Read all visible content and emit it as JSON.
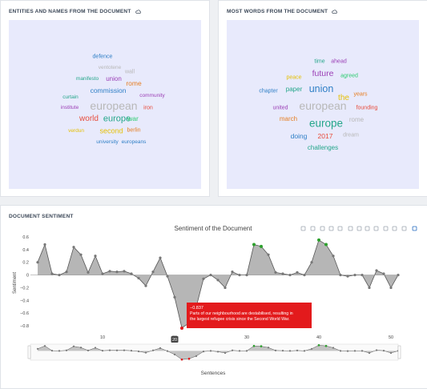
{
  "entities_card": {
    "title": "ENTITIES AND NAMES FROM THE DOCUMENT",
    "words": [
      {
        "text": "defence",
        "color": "#2f7fc6",
        "size": 7
      },
      {
        "text": "ventotene",
        "color": "#b8b8b8",
        "size": 6.5
      },
      {
        "text": "wall",
        "color": "#b8b8b8",
        "size": 7
      },
      {
        "text": "manifesto",
        "color": "#24a68a",
        "size": 6.5
      },
      {
        "text": "union",
        "color": "#9b3fb6",
        "size": 8
      },
      {
        "text": "rome",
        "color": "#e67e22",
        "size": 8.5
      },
      {
        "text": "commission",
        "color": "#2f7fc6",
        "size": 8.5
      },
      {
        "text": "curtain",
        "color": "#24a68a",
        "size": 6.5
      },
      {
        "text": "community",
        "color": "#9b3fb6",
        "size": 6.5
      },
      {
        "text": "institute",
        "color": "#9b3fb6",
        "size": 6.5
      },
      {
        "text": "european",
        "color": "#b8b8b8",
        "size": 14
      },
      {
        "text": "iron",
        "color": "#e74c3c",
        "size": 7
      },
      {
        "text": "world",
        "color": "#e74c3c",
        "size": 10
      },
      {
        "text": "europe",
        "color": "#24a68a",
        "size": 11
      },
      {
        "text": "war",
        "color": "#2ecc71",
        "size": 8.5
      },
      {
        "text": "verdun",
        "color": "#e5c007",
        "size": 6.5
      },
      {
        "text": "second",
        "color": "#e5c007",
        "size": 9
      },
      {
        "text": "berlin",
        "color": "#e67e22",
        "size": 7
      },
      {
        "text": "university",
        "color": "#2f7fc6",
        "size": 6.5
      },
      {
        "text": "europeans",
        "color": "#2f7fc6",
        "size": 6.5
      }
    ]
  },
  "words_card": {
    "title": "MOST WORDS FROM THE DOCUMENT",
    "words": [
      {
        "text": "time",
        "color": "#24a68a",
        "size": 7
      },
      {
        "text": "ahead",
        "color": "#9b3fb6",
        "size": 7
      },
      {
        "text": "future",
        "color": "#9b3fb6",
        "size": 10.5
      },
      {
        "text": "peace",
        "color": "#e5c007",
        "size": 7
      },
      {
        "text": "agreed",
        "color": "#2ecc71",
        "size": 7
      },
      {
        "text": "chapter",
        "color": "#2f7fc6",
        "size": 7
      },
      {
        "text": "paper",
        "color": "#24a68a",
        "size": 8
      },
      {
        "text": "union",
        "color": "#2f7fc6",
        "size": 12.5
      },
      {
        "text": "years",
        "color": "#e67e22",
        "size": 7
      },
      {
        "text": "the",
        "color": "#e5c007",
        "size": 10
      },
      {
        "text": "united",
        "color": "#9b3fb6",
        "size": 7
      },
      {
        "text": "european",
        "color": "#b8b8b8",
        "size": 14
      },
      {
        "text": "founding",
        "color": "#e74c3c",
        "size": 7
      },
      {
        "text": "march",
        "color": "#e67e22",
        "size": 8
      },
      {
        "text": "europe",
        "color": "#24a68a",
        "size": 13.5
      },
      {
        "text": "rome",
        "color": "#b8b8b8",
        "size": 8
      },
      {
        "text": "doing",
        "color": "#2f7fc6",
        "size": 8.5
      },
      {
        "text": "2017",
        "color": "#e74c3c",
        "size": 8.5
      },
      {
        "text": "dream",
        "color": "#b8b8b8",
        "size": 7
      },
      {
        "text": "challenges",
        "color": "#24a68a",
        "size": 8
      }
    ]
  },
  "sentiment_card": {
    "title": "DOCUMENT SENTIMENT",
    "toolbar_icons": [
      "camera-icon",
      "zoom-icon",
      "pan-icon",
      "box-select-icon",
      "lasso-icon",
      "zoom-in-icon",
      "zoom-out-icon",
      "autoscale-icon",
      "reset-axes-icon",
      "spike-lines-icon",
      "compare-hover-icon",
      "closest-hover-icon",
      "plotly-logo-icon"
    ]
  },
  "chart_data": {
    "type": "area",
    "title": "Sentiment of the Document",
    "xlabel": "Sentences",
    "ylabel": "Sentiment",
    "xlim": [
      0,
      51
    ],
    "ylim": [
      -0.9,
      0.65
    ],
    "x_ticks": [
      10,
      20,
      30,
      40,
      50
    ],
    "y_ticks": [
      0.6,
      0.4,
      0.2,
      0,
      -0.2,
      -0.4,
      -0.6,
      -0.8
    ],
    "y_tick_labels": [
      "0.6",
      "0.4",
      "0.2",
      "0",
      "−0.2",
      "−0.4",
      "−0.6",
      "−0.8"
    ],
    "grid": false,
    "fill_color": "#9e9e9e",
    "line_color": "#555555",
    "x": [
      1,
      2,
      3,
      4,
      5,
      6,
      7,
      8,
      9,
      10,
      11,
      12,
      13,
      14,
      15,
      16,
      17,
      18,
      19,
      20,
      21,
      22,
      23,
      24,
      25,
      26,
      27,
      28,
      29,
      30,
      31,
      32,
      33,
      34,
      35,
      36,
      37,
      38,
      39,
      40,
      41,
      42,
      43,
      44,
      45,
      46,
      47,
      48,
      49,
      50,
      51
    ],
    "y": [
      0.2,
      0.48,
      0.02,
      0.0,
      0.05,
      0.44,
      0.32,
      0.04,
      0.3,
      0.02,
      0.06,
      0.05,
      0.06,
      0.02,
      -0.05,
      -0.17,
      0.05,
      0.27,
      -0.02,
      -0.35,
      -0.83,
      -0.76,
      -0.5,
      -0.06,
      0.0,
      -0.08,
      -0.2,
      0.05,
      0.0,
      0.0,
      0.48,
      0.45,
      0.32,
      0.04,
      0.02,
      0.0,
      0.04,
      0.0,
      0.2,
      0.55,
      0.48,
      0.3,
      0.0,
      -0.02,
      0.0,
      0.0,
      -0.2,
      0.07,
      0.02,
      -0.2,
      0.0
    ],
    "highlight_points": [
      {
        "x": 21,
        "y": -0.837,
        "color": "#e31a1c"
      },
      {
        "x": 22,
        "y": -0.76,
        "color": "#e31a1c"
      },
      {
        "x": 31,
        "y": 0.48,
        "color": "#2ca02c"
      },
      {
        "x": 32,
        "y": 0.45,
        "color": "#2ca02c"
      },
      {
        "x": 40,
        "y": 0.55,
        "color": "#2ca02c"
      },
      {
        "x": 41,
        "y": 0.48,
        "color": "#2ca02c"
      }
    ],
    "hover": {
      "x_label": "20",
      "value": "−0.837",
      "text": "Parts of our neighbourhood are destabilised, resulting in the largest refugee crisis since the Second World War.",
      "color": "#e31a1c"
    }
  }
}
